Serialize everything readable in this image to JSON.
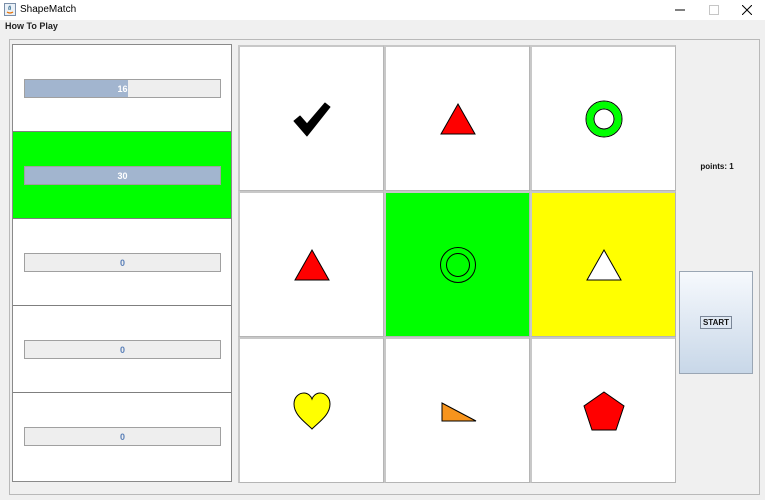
{
  "window": {
    "title": "ShapeMatch",
    "controls": [
      "minimize-icon",
      "maximize-icon",
      "close-icon"
    ]
  },
  "menu": {
    "items": [
      {
        "label": "How To Play"
      }
    ]
  },
  "progress_panel": {
    "bar_color": "#a2b5cf",
    "active_color": "#00ff00",
    "cells": [
      {
        "value": "16",
        "fill": 0.53,
        "active": false
      },
      {
        "value": "30",
        "fill": 1.0,
        "active": true
      },
      {
        "value": "0",
        "fill": 0,
        "active": false
      },
      {
        "value": "0",
        "fill": 0,
        "active": false
      },
      {
        "value": "0",
        "fill": 0,
        "active": false
      }
    ]
  },
  "grid": {
    "cells": [
      {
        "shape": "checkmark-icon",
        "color": "#000000",
        "background": "#ffffff"
      },
      {
        "shape": "triangle-icon",
        "color": "#ff0000",
        "background": "#ffffff"
      },
      {
        "shape": "ring-icon",
        "color": "#00ff00",
        "background": "#ffffff"
      },
      {
        "shape": "triangle-icon",
        "color": "#ff0000",
        "background": "#ffffff"
      },
      {
        "shape": "double-circle-icon",
        "color": "#000000",
        "background": "#00ff00"
      },
      {
        "shape": "triangle-icon",
        "color": "#ffffff",
        "background": "#ffff00"
      },
      {
        "shape": "heart-icon",
        "color": "#ffff00",
        "background": "#ffffff"
      },
      {
        "shape": "right-triangle-icon",
        "color": "#f7941d",
        "background": "#ffffff"
      },
      {
        "shape": "pentagon-icon",
        "color": "#ff0000",
        "background": "#ffffff"
      }
    ]
  },
  "score": {
    "label": "points: 1"
  },
  "start_button": {
    "label": "START"
  }
}
